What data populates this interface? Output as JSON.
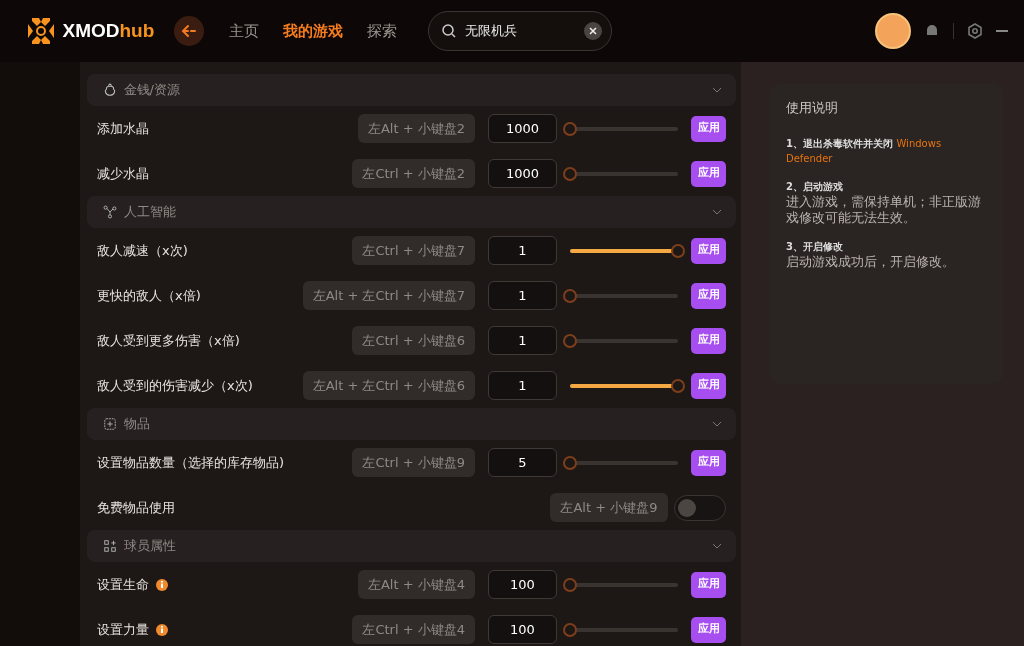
{
  "header": {
    "logo": "XMOD",
    "logo_accent": "hub",
    "nav": [
      {
        "label": "主页",
        "selected": false
      },
      {
        "label": "我的游戏",
        "selected": true
      },
      {
        "label": "探索",
        "selected": false
      }
    ],
    "search": {
      "value": "无限机兵"
    }
  },
  "sections": [
    {
      "title": "金钱/资源",
      "rows": [
        {
          "kind": "slider",
          "label": "添加水晶",
          "info": false,
          "hotkey": "左Alt + 小键盘2",
          "value": "1000",
          "level": 0,
          "action": "应用"
        },
        {
          "kind": "slider",
          "label": "减少水晶",
          "info": false,
          "hotkey": "左Ctrl + 小键盘2",
          "value": "1000",
          "level": 0,
          "action": "应用"
        }
      ]
    },
    {
      "title": "人工智能",
      "rows": [
        {
          "kind": "slider",
          "label": "敌人减速（x次)",
          "info": false,
          "hotkey": "左Ctrl + 小键盘7",
          "value": "1",
          "level": 1,
          "action": "应用"
        },
        {
          "kind": "slider",
          "label": "更快的敌人（x倍)",
          "info": false,
          "hotkey": "左Alt + 左Ctrl + 小键盘7",
          "value": "1",
          "level": 0,
          "action": "应用"
        },
        {
          "kind": "slider",
          "label": "敌人受到更多伤害（x倍)",
          "info": false,
          "hotkey": "左Ctrl + 小键盘6",
          "value": "1",
          "level": 0,
          "action": "应用"
        },
        {
          "kind": "slider",
          "label": "敌人受到的伤害减少（x次)",
          "info": false,
          "hotkey": "左Alt + 左Ctrl + 小键盘6",
          "value": "1",
          "level": 1,
          "action": "应用"
        }
      ]
    },
    {
      "title": "物品",
      "rows": [
        {
          "kind": "slider",
          "label": "设置物品数量（选择的库存物品)",
          "info": false,
          "hotkey": "左Ctrl + 小键盘9",
          "value": "5",
          "level": 0,
          "action": "应用"
        },
        {
          "kind": "toggle",
          "label": "免费物品使用",
          "info": false,
          "hotkey": "左Alt + 小键盘9",
          "on": false
        }
      ]
    },
    {
      "title": "球员属性",
      "rows": [
        {
          "kind": "slider",
          "label": "设置生命",
          "info": true,
          "hotkey": "左Alt + 小键盘4",
          "value": "100",
          "level": 0,
          "action": "应用"
        },
        {
          "kind": "slider",
          "label": "设置力量",
          "info": true,
          "hotkey": "左Ctrl + 小键盘4",
          "value": "100",
          "level": 0,
          "action": "应用"
        }
      ]
    }
  ],
  "instructions": {
    "title": "使用说明",
    "steps": [
      {
        "title": "1、退出杀毒软件并关闭 ",
        "highlight": "Windows Defender"
      },
      {
        "title": "2、启动游戏",
        "text": "进入游戏，需保持单机；非正版游戏修改可能无法生效。"
      },
      {
        "title": "3、开启修改",
        "text": "启动游戏成功后，开启修改。"
      }
    ]
  }
}
